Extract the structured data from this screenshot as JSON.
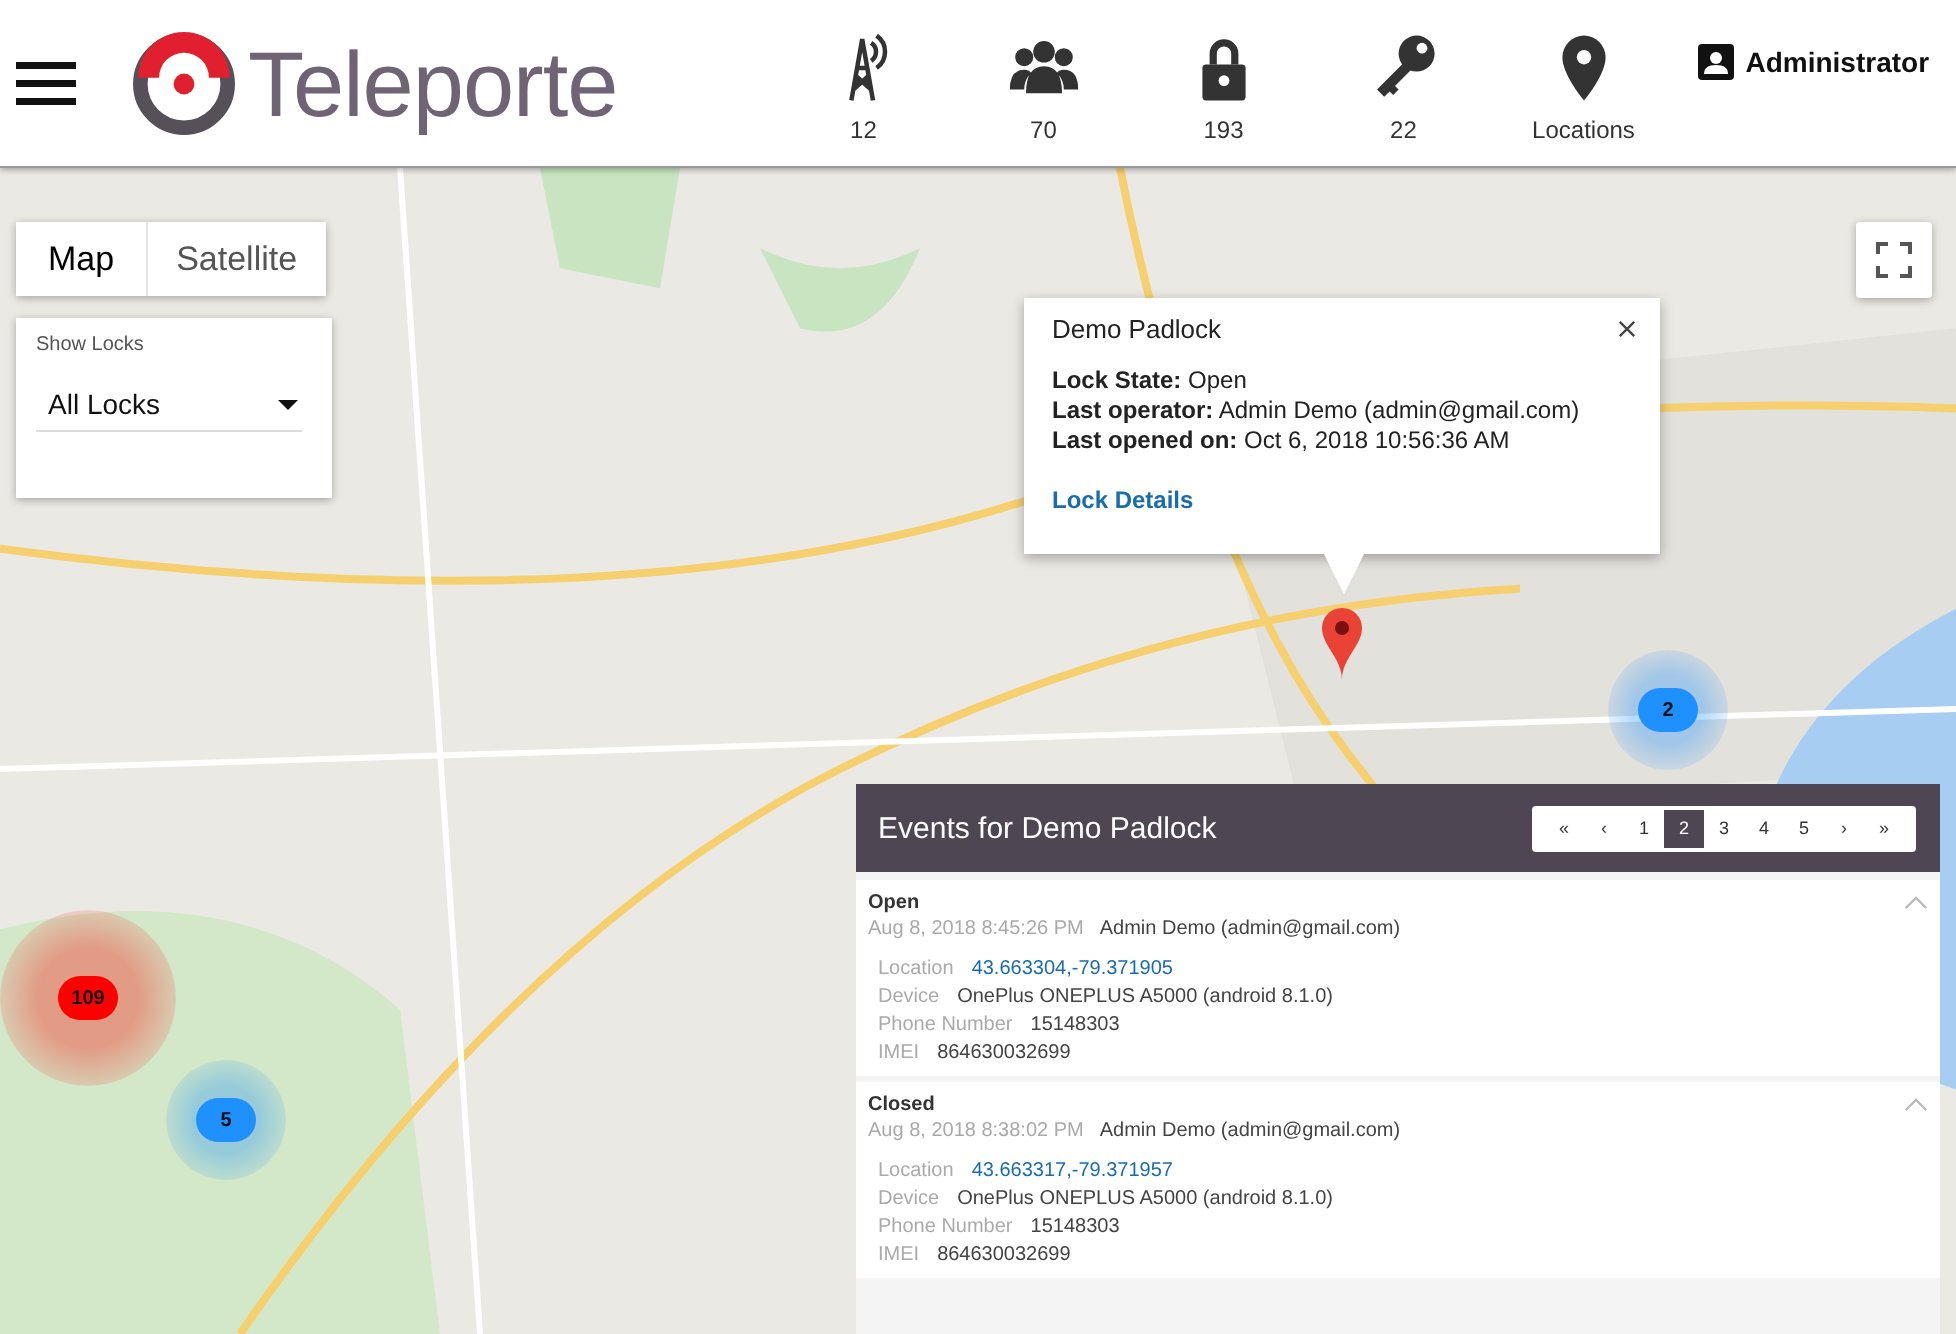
{
  "header": {
    "brand": "Teleporte",
    "stats": [
      {
        "kind": "tower",
        "label": "12"
      },
      {
        "kind": "users",
        "label": "70"
      },
      {
        "kind": "lock",
        "label": "193"
      },
      {
        "kind": "key",
        "label": "22"
      },
      {
        "kind": "pin",
        "label": "Locations"
      }
    ],
    "user": "Administrator"
  },
  "map": {
    "type_tabs": [
      {
        "label": "Map",
        "selected": true
      },
      {
        "label": "Satellite",
        "selected": false
      }
    ],
    "filter": {
      "label": "Show Locks",
      "value": "All Locks"
    },
    "popup": {
      "title": "Demo Padlock",
      "lines": [
        {
          "label": "Lock State:",
          "value": "Open"
        },
        {
          "label": "Last operator:",
          "value": "Admin Demo (admin@gmail.com)"
        },
        {
          "label": "Last opened on:",
          "value": "Oct 6, 2018 10:56:36 AM"
        }
      ],
      "link": "Lock Details"
    },
    "clusters": [
      {
        "count": "109",
        "color": "#ff0000"
      },
      {
        "count": "5",
        "color": "#1e90ff"
      },
      {
        "count": "2",
        "color": "#1e90ff"
      }
    ]
  },
  "events": {
    "title": "Events for Demo Padlock",
    "pages": [
      {
        "label": "«",
        "selected": false
      },
      {
        "label": "‹",
        "selected": false
      },
      {
        "label": "1",
        "selected": false
      },
      {
        "label": "2",
        "selected": true
      },
      {
        "label": "3",
        "selected": false
      },
      {
        "label": "4",
        "selected": false
      },
      {
        "label": "5",
        "selected": false
      },
      {
        "label": "›",
        "selected": false
      },
      {
        "label": "»",
        "selected": false
      }
    ],
    "items": [
      {
        "title": "Open",
        "time": "Aug 8, 2018 8:45:26 PM",
        "operator": "Admin Demo (admin@gmail.com)",
        "fields": [
          {
            "kind": "link",
            "label": "Location",
            "value": "43.663304,-79.371905"
          },
          {
            "kind": "text",
            "label": "Device",
            "value": "OnePlus ONEPLUS A5000 (android 8.1.0)"
          },
          {
            "kind": "text",
            "label": "Phone Number",
            "value": "15148303"
          },
          {
            "kind": "text",
            "label": "IMEI",
            "value": "864630032699"
          }
        ]
      },
      {
        "title": "Closed",
        "time": "Aug 8, 2018 8:38:02 PM",
        "operator": "Admin Demo (admin@gmail.com)",
        "fields": [
          {
            "kind": "link",
            "label": "Location",
            "value": "43.663317,-79.371957"
          },
          {
            "kind": "text",
            "label": "Device",
            "value": "OnePlus ONEPLUS A5000 (android 8.1.0)"
          },
          {
            "kind": "text",
            "label": "Phone Number",
            "value": "15148303"
          },
          {
            "kind": "text",
            "label": "IMEI",
            "value": "864630032699"
          }
        ]
      }
    ]
  }
}
